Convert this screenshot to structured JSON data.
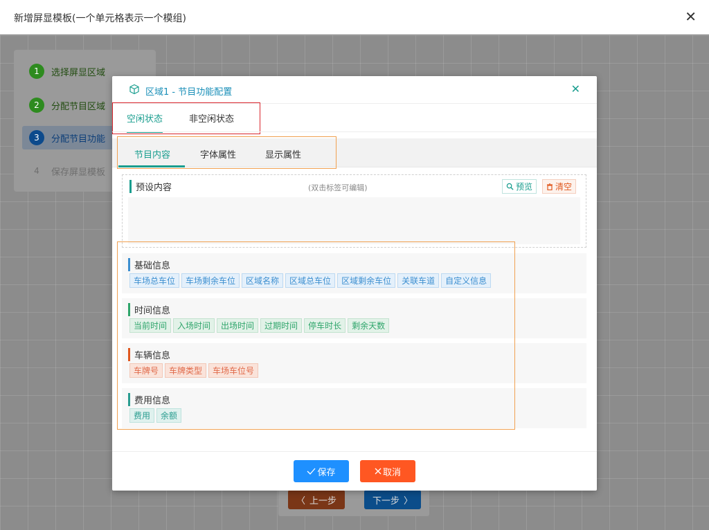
{
  "window": {
    "title": "新增屏显模板(一个单元格表示一个模组)",
    "close_glyph": "✕"
  },
  "steps": [
    {
      "num": "1",
      "label": "选择屏显区域",
      "state": "done"
    },
    {
      "num": "2",
      "label": "分配节目区域",
      "state": "done"
    },
    {
      "num": "3",
      "label": "分配节目功能",
      "state": "active"
    },
    {
      "num": "4",
      "label": "保存屏显模板",
      "state": "todo"
    }
  ],
  "nav": {
    "prev_label": "上一步",
    "next_label": "下一步",
    "prev_glyph": "〈",
    "next_glyph": "〉"
  },
  "modal": {
    "title": "区域1 - 节目功能配置",
    "close_glyph": "✕",
    "state_tabs": [
      "空闲状态",
      "非空闲状态"
    ],
    "active_state_tab": "空闲状态",
    "content_tabs": [
      "节目内容",
      "字体属性",
      "显示属性"
    ],
    "active_content_tab": "节目内容",
    "preset": {
      "header": "预设内容",
      "hint": "(双击标签可编辑)",
      "preview_label": "预览",
      "clear_label": "清空"
    },
    "groups": [
      {
        "header": "基础信息",
        "color": "#3d8fd0",
        "style": "t-blue",
        "tags": [
          "车场总车位",
          "车场剩余车位",
          "区域名称",
          "区域总车位",
          "区域剩余车位",
          "关联车道",
          "自定义信息"
        ]
      },
      {
        "header": "时间信息",
        "color": "#2fa56b",
        "style": "t-green",
        "tags": [
          "当前时间",
          "入场时间",
          "出场时间",
          "过期时间",
          "停车时长",
          "剩余天数"
        ]
      },
      {
        "header": "车辆信息",
        "color": "#e0581f",
        "style": "t-red",
        "tags": [
          "车牌号",
          "车牌类型",
          "车场车位号"
        ]
      },
      {
        "header": "费用信息",
        "color": "#2a9d90",
        "style": "t-teal",
        "tags": [
          "费用",
          "余额"
        ]
      }
    ],
    "save_label": "保存",
    "cancel_label": "取消"
  }
}
